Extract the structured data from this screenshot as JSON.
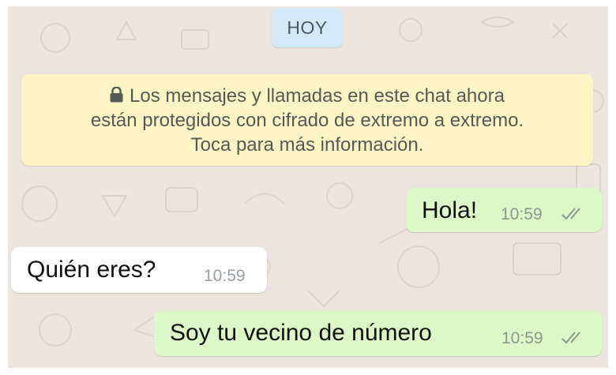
{
  "chat": {
    "date_chip": "HOY",
    "encryption_notice": {
      "lines": [
        "Los mensajes y llamadas en este chat ahora",
        "están protegidos con cifrado de extremo a extremo.",
        "Toca para más información."
      ],
      "icon": "lock-icon"
    },
    "messages": [
      {
        "direction": "outgoing",
        "text": "Hola!",
        "time": "10:59",
        "status": "read-double-check"
      },
      {
        "direction": "incoming",
        "text": "Quién eres?",
        "time": "10:59"
      },
      {
        "direction": "outgoing",
        "text": "Soy tu vecino de número",
        "time": "10:59",
        "status": "read-double-check"
      }
    ]
  },
  "colors": {
    "wallpaper": "#ece5dd",
    "date_chip": "#d3e9f5",
    "notice": "#fdf4c5",
    "outgoing_bubble": "#dcf8c6",
    "incoming_bubble": "#ffffff"
  }
}
